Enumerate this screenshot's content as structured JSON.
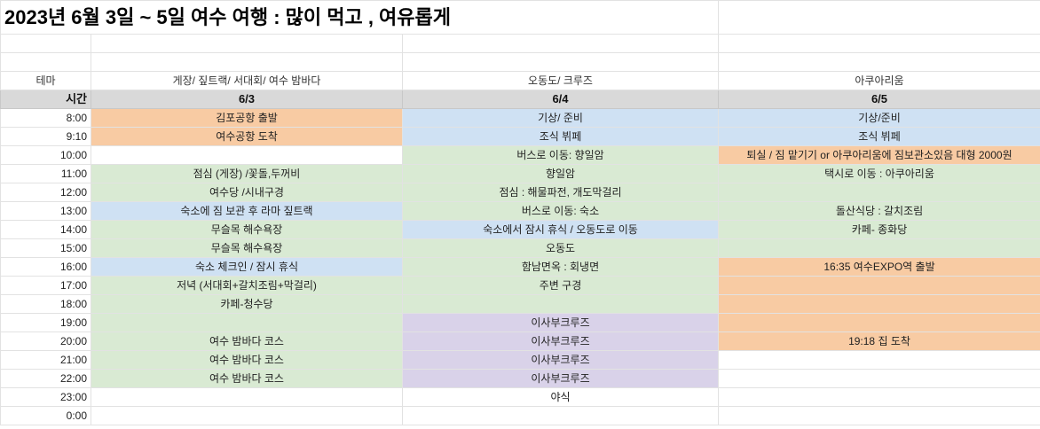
{
  "title": "2023년   6월 3일 ~ 5일 여수 여행   :  많이 먹고 , 여유롭게",
  "theme_row": {
    "label": "테마",
    "day1": "게장/ 짚트랙/ 서대회/ 여수 밤바다",
    "day2": "오동도/ 크루즈",
    "day3": "아쿠아리움"
  },
  "header_row": {
    "label": "시간",
    "day1": "6/3",
    "day2": "6/4",
    "day3": "6/5"
  },
  "schedule": [
    {
      "time": "8:00",
      "day1": "김포공항 출발",
      "day2": "기상/ 준비",
      "day3": "기상/준비"
    },
    {
      "time": "9:10",
      "day1": "여수공항 도착",
      "day2": "조식 뷔페",
      "day3": "조식 뷔페"
    },
    {
      "time": "10:00",
      "day1": "",
      "day2": "버스로 이동: 향일암",
      "day3": "퇴실 / 짐 맡기기 or 아쿠아리움에 짐보관소있음 대형 2000원"
    },
    {
      "time": "11:00",
      "day1": "점심 (게장)  /꽃돌,두꺼비",
      "day2": "향일암",
      "day3": "택시로 이동 : 아쿠아리움"
    },
    {
      "time": "12:00",
      "day1": "여수당 /시내구경",
      "day2": "점심 : 해물파전, 개도막걸리",
      "day3": ""
    },
    {
      "time": "13:00",
      "day1": "숙소에 짐 보관 후  라마 짚트랙",
      "day2": "버스로 이동: 숙소",
      "day3": "돌산식당 : 갈치조림"
    },
    {
      "time": "14:00",
      "day1": "무슬목 해수욕장",
      "day2": "숙소에서 잠시 휴식 / 오동도로 이동",
      "day3": "카페- 종화당"
    },
    {
      "time": "15:00",
      "day1": "무슬목 해수욕장",
      "day2": "오동도",
      "day3": ""
    },
    {
      "time": "16:00",
      "day1": "숙소 체크인 / 잠시 휴식",
      "day2": "함남면옥 : 회냉면",
      "day3": "16:35 여수EXPO역 출발"
    },
    {
      "time": "17:00",
      "day1": "저녁 (서대회+갈치조림+막걸리)",
      "day2": "주변 구경",
      "day3": ""
    },
    {
      "time": "18:00",
      "day1": "카페-청수당",
      "day2": "",
      "day3": ""
    },
    {
      "time": "19:00",
      "day1": "",
      "day2": "이사부크루즈",
      "day3": ""
    },
    {
      "time": "20:00",
      "day1": "여수 밤바다 코스",
      "day2": "이사부크루즈",
      "day3": "19:18 집 도착"
    },
    {
      "time": "21:00",
      "day1": "여수 밤바다 코스",
      "day2": "이사부크루즈",
      "day3": ""
    },
    {
      "time": "22:00",
      "day1": "여수 밤바다 코스",
      "day2": "이사부크루즈",
      "day3": ""
    },
    {
      "time": "23:00",
      "day1": "",
      "day2": "야식",
      "day3": ""
    },
    {
      "time": "0:00",
      "day1": "",
      "day2": "",
      "day3": ""
    }
  ],
  "colors": {
    "orange": "#f8cba3",
    "blue": "#cfe1f3",
    "green": "#d9ead3",
    "purple": "#d9d2e9",
    "header_gray": "#d9d9d9"
  }
}
